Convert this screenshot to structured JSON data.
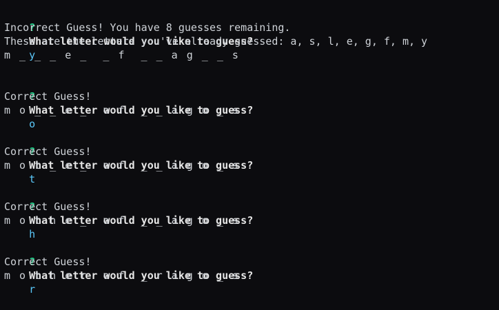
{
  "terminal": {
    "prompt_marker": "?",
    "question": "What letter would you like to guess?",
    "blocks": [
      {
        "answer": "y",
        "messages": [
          "Incorrect Guess! You have 8 guesses remaining.",
          "These are the letters you've already guessed: a, s, l, e, g, f, m, y"
        ],
        "mask": "m _ _ _ e _  _ f  _ _ a g _ _ s"
      },
      {
        "answer": "o",
        "messages": [
          "Correct Guess!"
        ],
        "mask": "m o _ _ e _  o f  _ _ a g o _ s"
      },
      {
        "answer": "t",
        "messages": [
          "Correct Guess!"
        ],
        "mask": "m o t _ e _  o f  _ _ a g o _ s"
      },
      {
        "answer": "h",
        "messages": [
          "Correct Guess!"
        ],
        "mask": "m o t h e _  o f  _ _ a g o _ s"
      },
      {
        "answer": "r",
        "messages": [
          "Correct Guess!"
        ],
        "mask": "m o t h e r  o f  _ r a g o _ s"
      }
    ]
  }
}
